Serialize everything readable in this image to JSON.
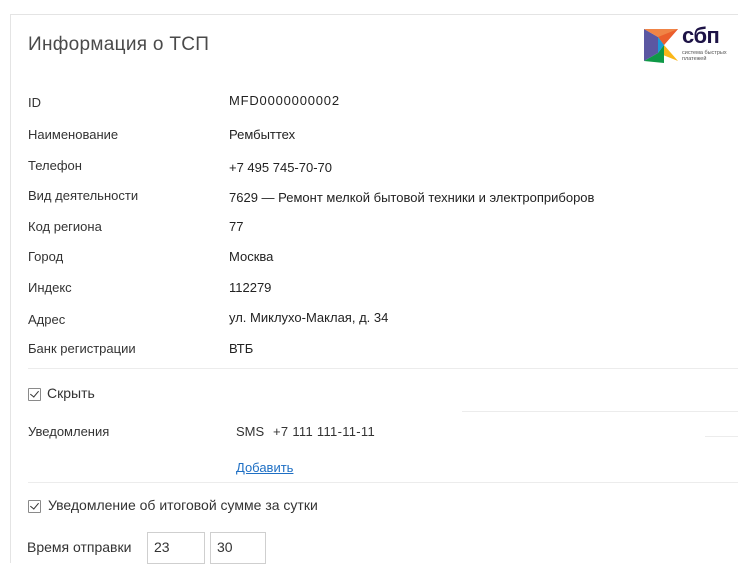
{
  "header": {
    "title": "Информация о ТСП",
    "logo_word": "сбп",
    "logo_sub": "система быстрых платежей"
  },
  "fields": [
    {
      "label": "ID",
      "value": "MFD0000000002"
    },
    {
      "label": "Наименование",
      "value": "Рембыттех"
    },
    {
      "label": "Телефон",
      "value": "+7 495 745-70-70"
    },
    {
      "label": "Вид деятельности",
      "value": "7629 — Ремонт мелкой бытовой техники и электроприборов"
    },
    {
      "label": "Код региона",
      "value": "77"
    },
    {
      "label": "Город",
      "value": "Москва"
    },
    {
      "label": "Индекс",
      "value": "112279"
    },
    {
      "label": "Адрес",
      "value": "ул. Миклухо-Маклая, д. 34"
    },
    {
      "label": "Банк регистрации",
      "value": "ВТБ"
    }
  ],
  "hide_toggle": {
    "label": "Скрыть",
    "checked": true
  },
  "notifications": {
    "label": "Уведомления",
    "channel": "SMS",
    "phone": "+7 111 111-11-11",
    "add_link": "Добавить"
  },
  "daily_summary": {
    "label": "Уведомление об итоговой сумме за сутки",
    "checked": true
  },
  "send_time": {
    "label": "Время отправки",
    "hours": "23",
    "minutes": "30"
  },
  "colors": {
    "link": "#1e6fc4",
    "logo_dark": "#1d1346"
  }
}
